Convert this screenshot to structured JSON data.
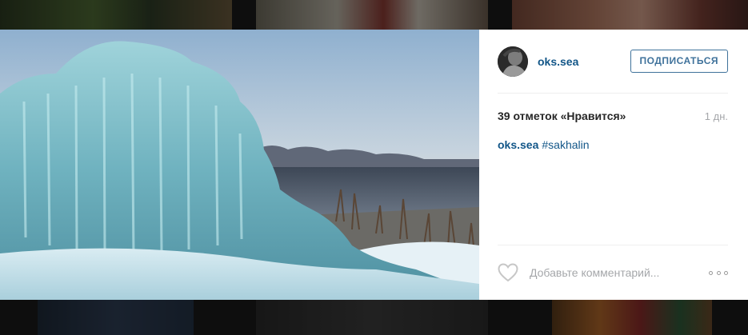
{
  "post": {
    "username": "oks.sea",
    "follow_label": "ПОДПИСАТЬСЯ",
    "likes_text": "39 отметок «Нравится»",
    "age": "1 дн.",
    "caption": {
      "user": "oks.sea",
      "hashtag": "#sakhalin"
    },
    "comment_placeholder": "Добавьте комментарий..."
  },
  "icons": {
    "avatar": "avatar",
    "like": "heart-outline-icon",
    "more": "more-options-icon"
  },
  "colors": {
    "link": "#125688",
    "button": "#3f729b",
    "muted": "#a5a7aa"
  }
}
